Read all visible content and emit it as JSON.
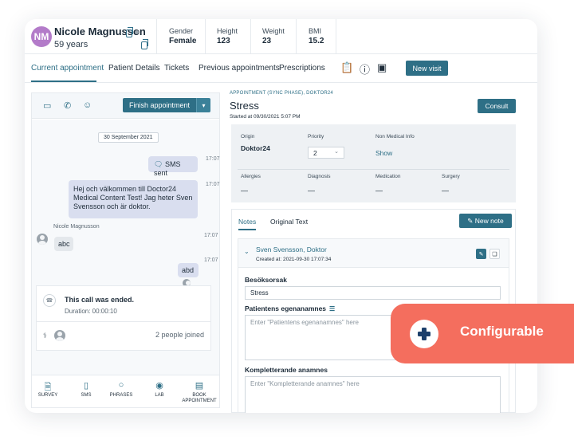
{
  "patient": {
    "initials": "NM",
    "name": "Nicole Magnusson",
    "age": "59 years",
    "stats": [
      {
        "label": "Gender",
        "value": "Female"
      },
      {
        "label": "Height",
        "value": "123"
      },
      {
        "label": "Weight",
        "value": "23"
      },
      {
        "label": "BMI",
        "value": "15.2"
      }
    ]
  },
  "tabs": [
    "Current appointment",
    "Patient Details",
    "Tickets",
    "Previous appointments",
    "Prescriptions"
  ],
  "new_visit_label": "New visit",
  "call_panel": {
    "finish_label": "Finish appointment",
    "date": "30 September 2021",
    "messages": [
      {
        "text": "SMS sent",
        "time": "17:07"
      },
      {
        "text": "Hej och välkommen till Doctor24 Medical Content Test! Jag heter Sven Svensson och är doktor.",
        "time": "17:07"
      },
      {
        "sender": "Nicole Magnusson",
        "text": "abc",
        "time": "17:07"
      },
      {
        "text": "abd",
        "time": "17:07"
      }
    ],
    "call_ended": "This call was ended.",
    "duration": "Duration: 00:00:10",
    "joined": "2 people joined",
    "bottom_nav": [
      {
        "label": "SURVEY",
        "icon": "document-icon"
      },
      {
        "label": "SMS",
        "icon": "phone-icon"
      },
      {
        "label": "PHRASES",
        "icon": "speech-bubble-icon"
      },
      {
        "label": "LAB",
        "icon": "location-pin-icon"
      },
      {
        "label": "BOOK APPOINTMENT",
        "icon": "calendar-icon"
      }
    ]
  },
  "appointment": {
    "phase": "APPOINTMENT (SYNC PHASE), DOKTOR24",
    "title": "Stress",
    "started": "Started at 09/30/2021 5:07 PM",
    "consult_label": "Consult",
    "origin_label": "Origin",
    "origin": "Doktor24",
    "priority_label": "Priority",
    "priority": "2",
    "non_medical_label": "Non Medical Info",
    "show_label": "Show",
    "allergies_label": "Allergies",
    "diagnosis_label": "Diagnosis",
    "medication_label": "Medication",
    "surgery_label": "Surgery",
    "empty": "—"
  },
  "notes": {
    "tab_notes": "Notes",
    "tab_original": "Original Text",
    "new_note_label": "New note",
    "author": "Sven Svensson, Doktor",
    "created": "Created at: 2021-09-30 17:07:34",
    "reason_label": "Besöksorsak",
    "reason_value": "Stress",
    "self_history_label": "Patientens egenanamnes",
    "self_history_placeholder": "Enter \"Patientens egenanamnes\" here",
    "supplementary_label": "Kompletterande anamnes",
    "supplementary_placeholder": "Enter \"Kompletterande anamnes\" here"
  },
  "badge": {
    "label": "Configurable"
  },
  "colors": {
    "accent": "#2e6f86",
    "badge": "#f46e5e",
    "avatar": "#b37bc9"
  }
}
